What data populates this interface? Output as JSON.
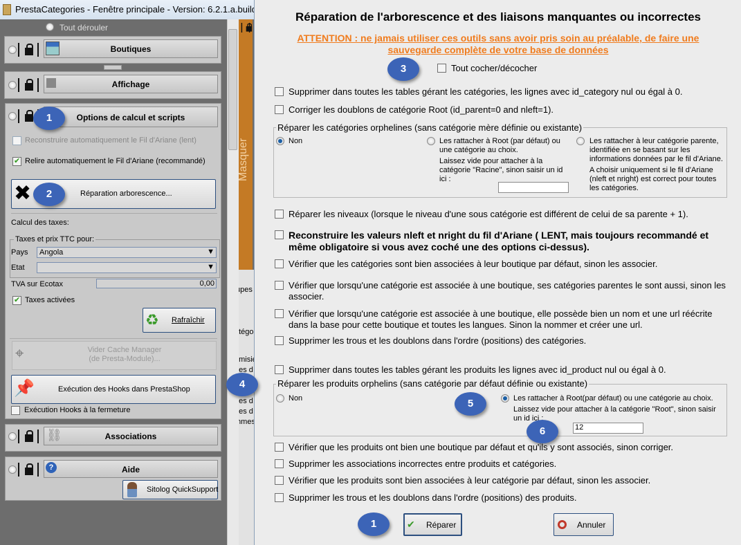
{
  "window": {
    "title": "PrestaCategories - Fenêtre principale  -  Version:  6.2.1.a.build1.6"
  },
  "left": {
    "expand_all": "Tout dérouler",
    "sections": {
      "boutiques": "Boutiques",
      "affichage": "Affichage",
      "options": "Options de calcul et scripts",
      "associations": "Associations",
      "aide": "Aide"
    },
    "options": {
      "rebuild_auto": "Reconstruire automatiquement le Fil d'Ariane (lent)",
      "reread_auto": "Relire automatiquement le Fil d'Ariane (recommandé)",
      "repair_button": "Réparation arborescence...",
      "tax_title": "Calcul des taxes:",
      "tax_group": "Taxes et prix TTC pour:",
      "country_label": "Pays",
      "country_value": "Angola",
      "state_label": "Etat",
      "state_value": "",
      "ecotax_label": "TVA sur Ecotax",
      "ecotax_value": "0,00",
      "taxes_enabled": "Taxes activées",
      "refresh": "Rafraîchir",
      "cache_manager": "Vider Cache Manager",
      "cache_manager_sub": "(de Presta-Module)...",
      "hooks_button": "Exécution des Hooks dans PrestaShop",
      "hooks_on_close": "Exécution Hooks à la fermeture"
    },
    "quicksupport": "Sitolog QuickSupport",
    "hide_tab": "Masquer",
    "behind_text": [
      "upes",
      "atégo",
      "emisie",
      "pes d",
      "pes d",
      "pes d",
      "mmes"
    ]
  },
  "dialog": {
    "title": "Réparation de l'arborescence et des liaisons manquantes ou incorrectes",
    "warning_line1": "ATTENTION : ne jamais utiliser ces outils sans avoir pris soin au préalable, de faire une",
    "warning_line2": "sauvegarde complète de votre base de données",
    "check_all": "Tout cocher/décocher",
    "cat_rows": [
      "Supprimer dans toutes les tables gérant les catégories, les lignes avec id_category nul ou égal à 0.",
      "Corriger les doublons de catégorie Root  (id_parent=0 and nleft=1)."
    ],
    "orphan_cats": {
      "legend": "Réparer les catégories orphelines (sans catégorie mère définie ou existante)",
      "non": "Non",
      "root_opt": "Les rattacher à Root (par défaut) ou une catégorie au choix.",
      "root_hint": "Laissez vide pour attacher à la catégorie \"Racine\", sinon saisir un id ici :",
      "root_value": "",
      "parent_opt": "Les rattacher à leur catégorie parente, identifiée en se basant sur les informations données par le fil d'Ariane.",
      "parent_hint": "A choisir uniquement si le fil d'Ariane (nleft et nright) est correct pour toutes les catégories.",
      "selected": "non"
    },
    "levels": "Réparer les niveaux (lorsque le niveau d'une sous catégorie est différent de celui de sa parente + 1).",
    "rebuild": "Reconstruire les valeurs nleft et nright du fil d'Ariane ( LENT, mais toujours recommandé et même obligatoire si vous avez coché une des options ci-dessus).",
    "shop_rows": [
      "Vérifier que les catégories sont bien associées à leur boutique par défaut, sinon les associer.",
      "Vérifier que lorsqu'une catégorie est associée à une boutique, ses catégories parentes le sont aussi, sinon les associer.",
      "Vérifier que lorsqu'une catégorie est associée à une boutique, elle possède bien un nom et une url réécrite dans la base pour cette boutique et toutes les langues. Sinon la nommer et créer une url.",
      "Supprimer les trous et les doublons dans l'ordre (positions) des catégories.",
      "Supprimer dans toutes les tables gérant les produits les lignes avec id_product nul ou égal à 0."
    ],
    "orphan_products": {
      "legend": "Réparer les produits orphelins (sans catégorie par défaut définie ou existante)",
      "non": "Non",
      "root_opt": "Les rattacher à Root(par défaut) ou une catégorie au choix.",
      "root_hint": "Laissez vide pour attacher à la catégorie \"Root\", sinon saisir un id ici :",
      "root_value": "12",
      "selected": "root"
    },
    "product_rows": [
      "Vérifier que les produits ont bien une boutique par défaut et qu'ils y sont associés, sinon corriger.",
      "Supprimer les associations incorrectes entre produits et catégories.",
      "Vérifier que les produits sont bien associées à leur catégorie par défaut, sinon les associer.",
      "Supprimer les trous et les doublons dans l'ordre (positions) des produits."
    ],
    "repair": "Réparer",
    "cancel": "Annuler"
  },
  "callouts": [
    "1",
    "2",
    "3",
    "4",
    "5",
    "6",
    "1"
  ],
  "colors": {
    "warning": "#f07c1e",
    "callout": "#3c64b7",
    "hide_tab": "#c47a25"
  }
}
